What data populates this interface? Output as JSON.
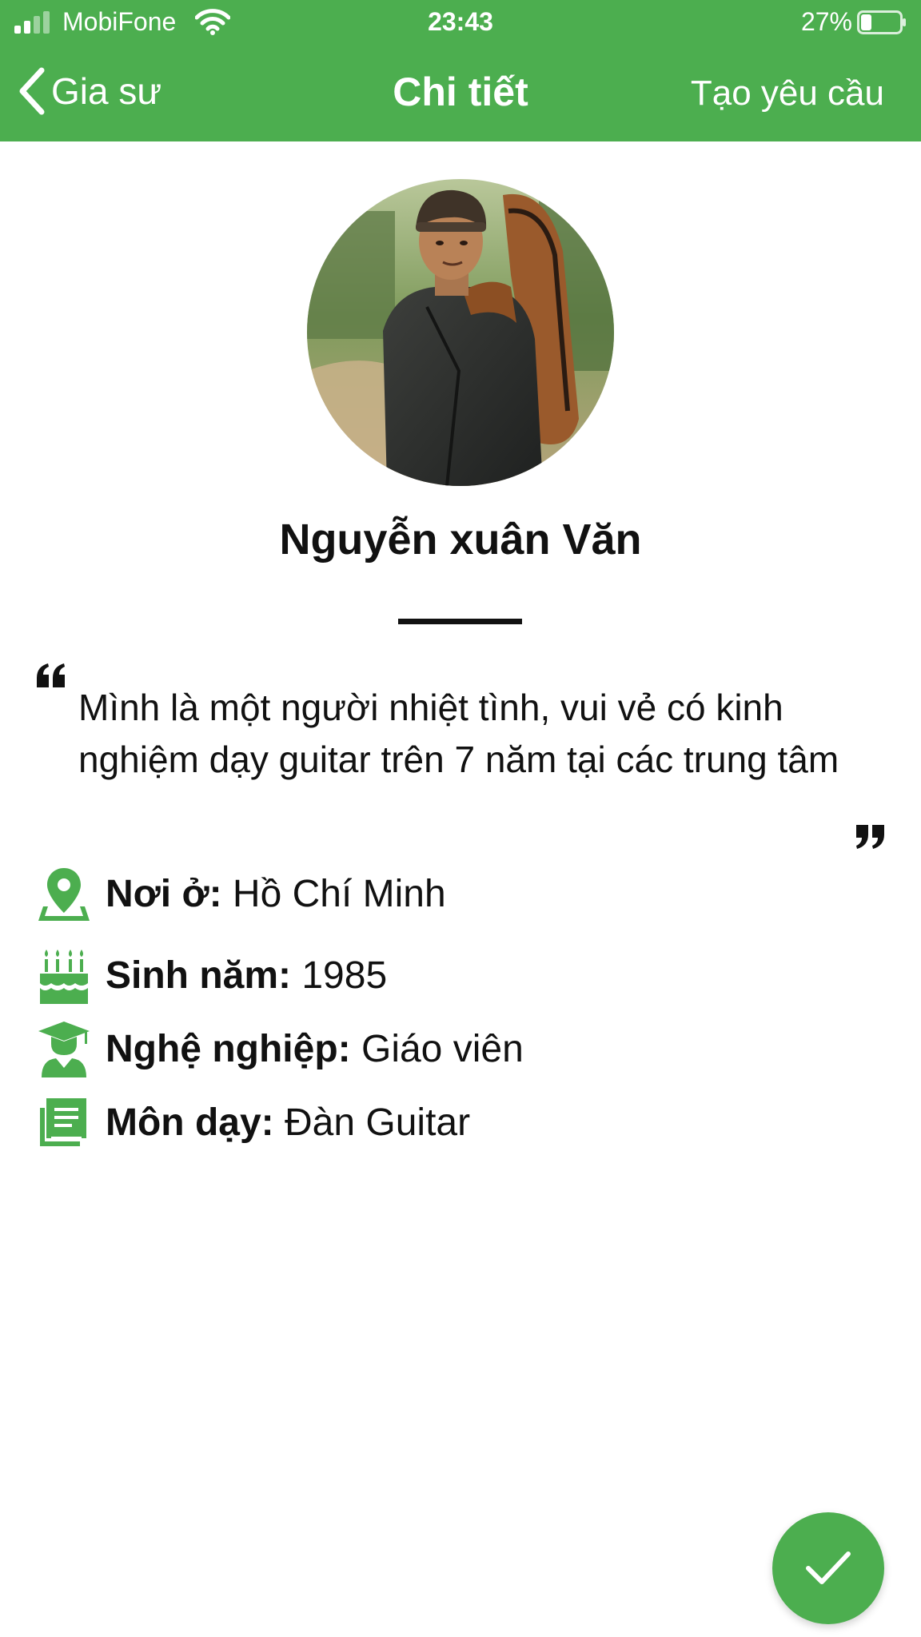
{
  "status_bar": {
    "carrier": "MobiFone",
    "time": "23:43",
    "battery_percent": "27%",
    "battery_level": 0.27,
    "signal_bars": 2
  },
  "nav": {
    "back_label": "Gia sư",
    "title": "Chi tiết",
    "action_label": "Tạo yêu cầu"
  },
  "profile": {
    "name": "Nguyễn xuân Văn",
    "avatar_icon": "profile-photo",
    "quote": "Mình là một người nhiệt tình, vui vẻ có kinh nghiệm dạy guitar trên 7 năm tại các trung tâm"
  },
  "details": [
    {
      "icon": "location-pin-icon",
      "label": "Nơi ở:",
      "value": " Hồ Chí Minh"
    },
    {
      "icon": "birthday-cake-icon",
      "label": "Sinh năm:",
      "value": " 1985"
    },
    {
      "icon": "graduate-icon",
      "label": "Nghệ nghiệp:",
      "value": " Giáo viên"
    },
    {
      "icon": "subject-book-icon",
      "label": "Môn dạy:",
      "value": " Đàn Guitar"
    }
  ],
  "fab": {
    "icon": "checkmark-icon"
  },
  "colors": {
    "primary": "#4cae4f",
    "text": "#111111",
    "background": "#ffffff"
  }
}
